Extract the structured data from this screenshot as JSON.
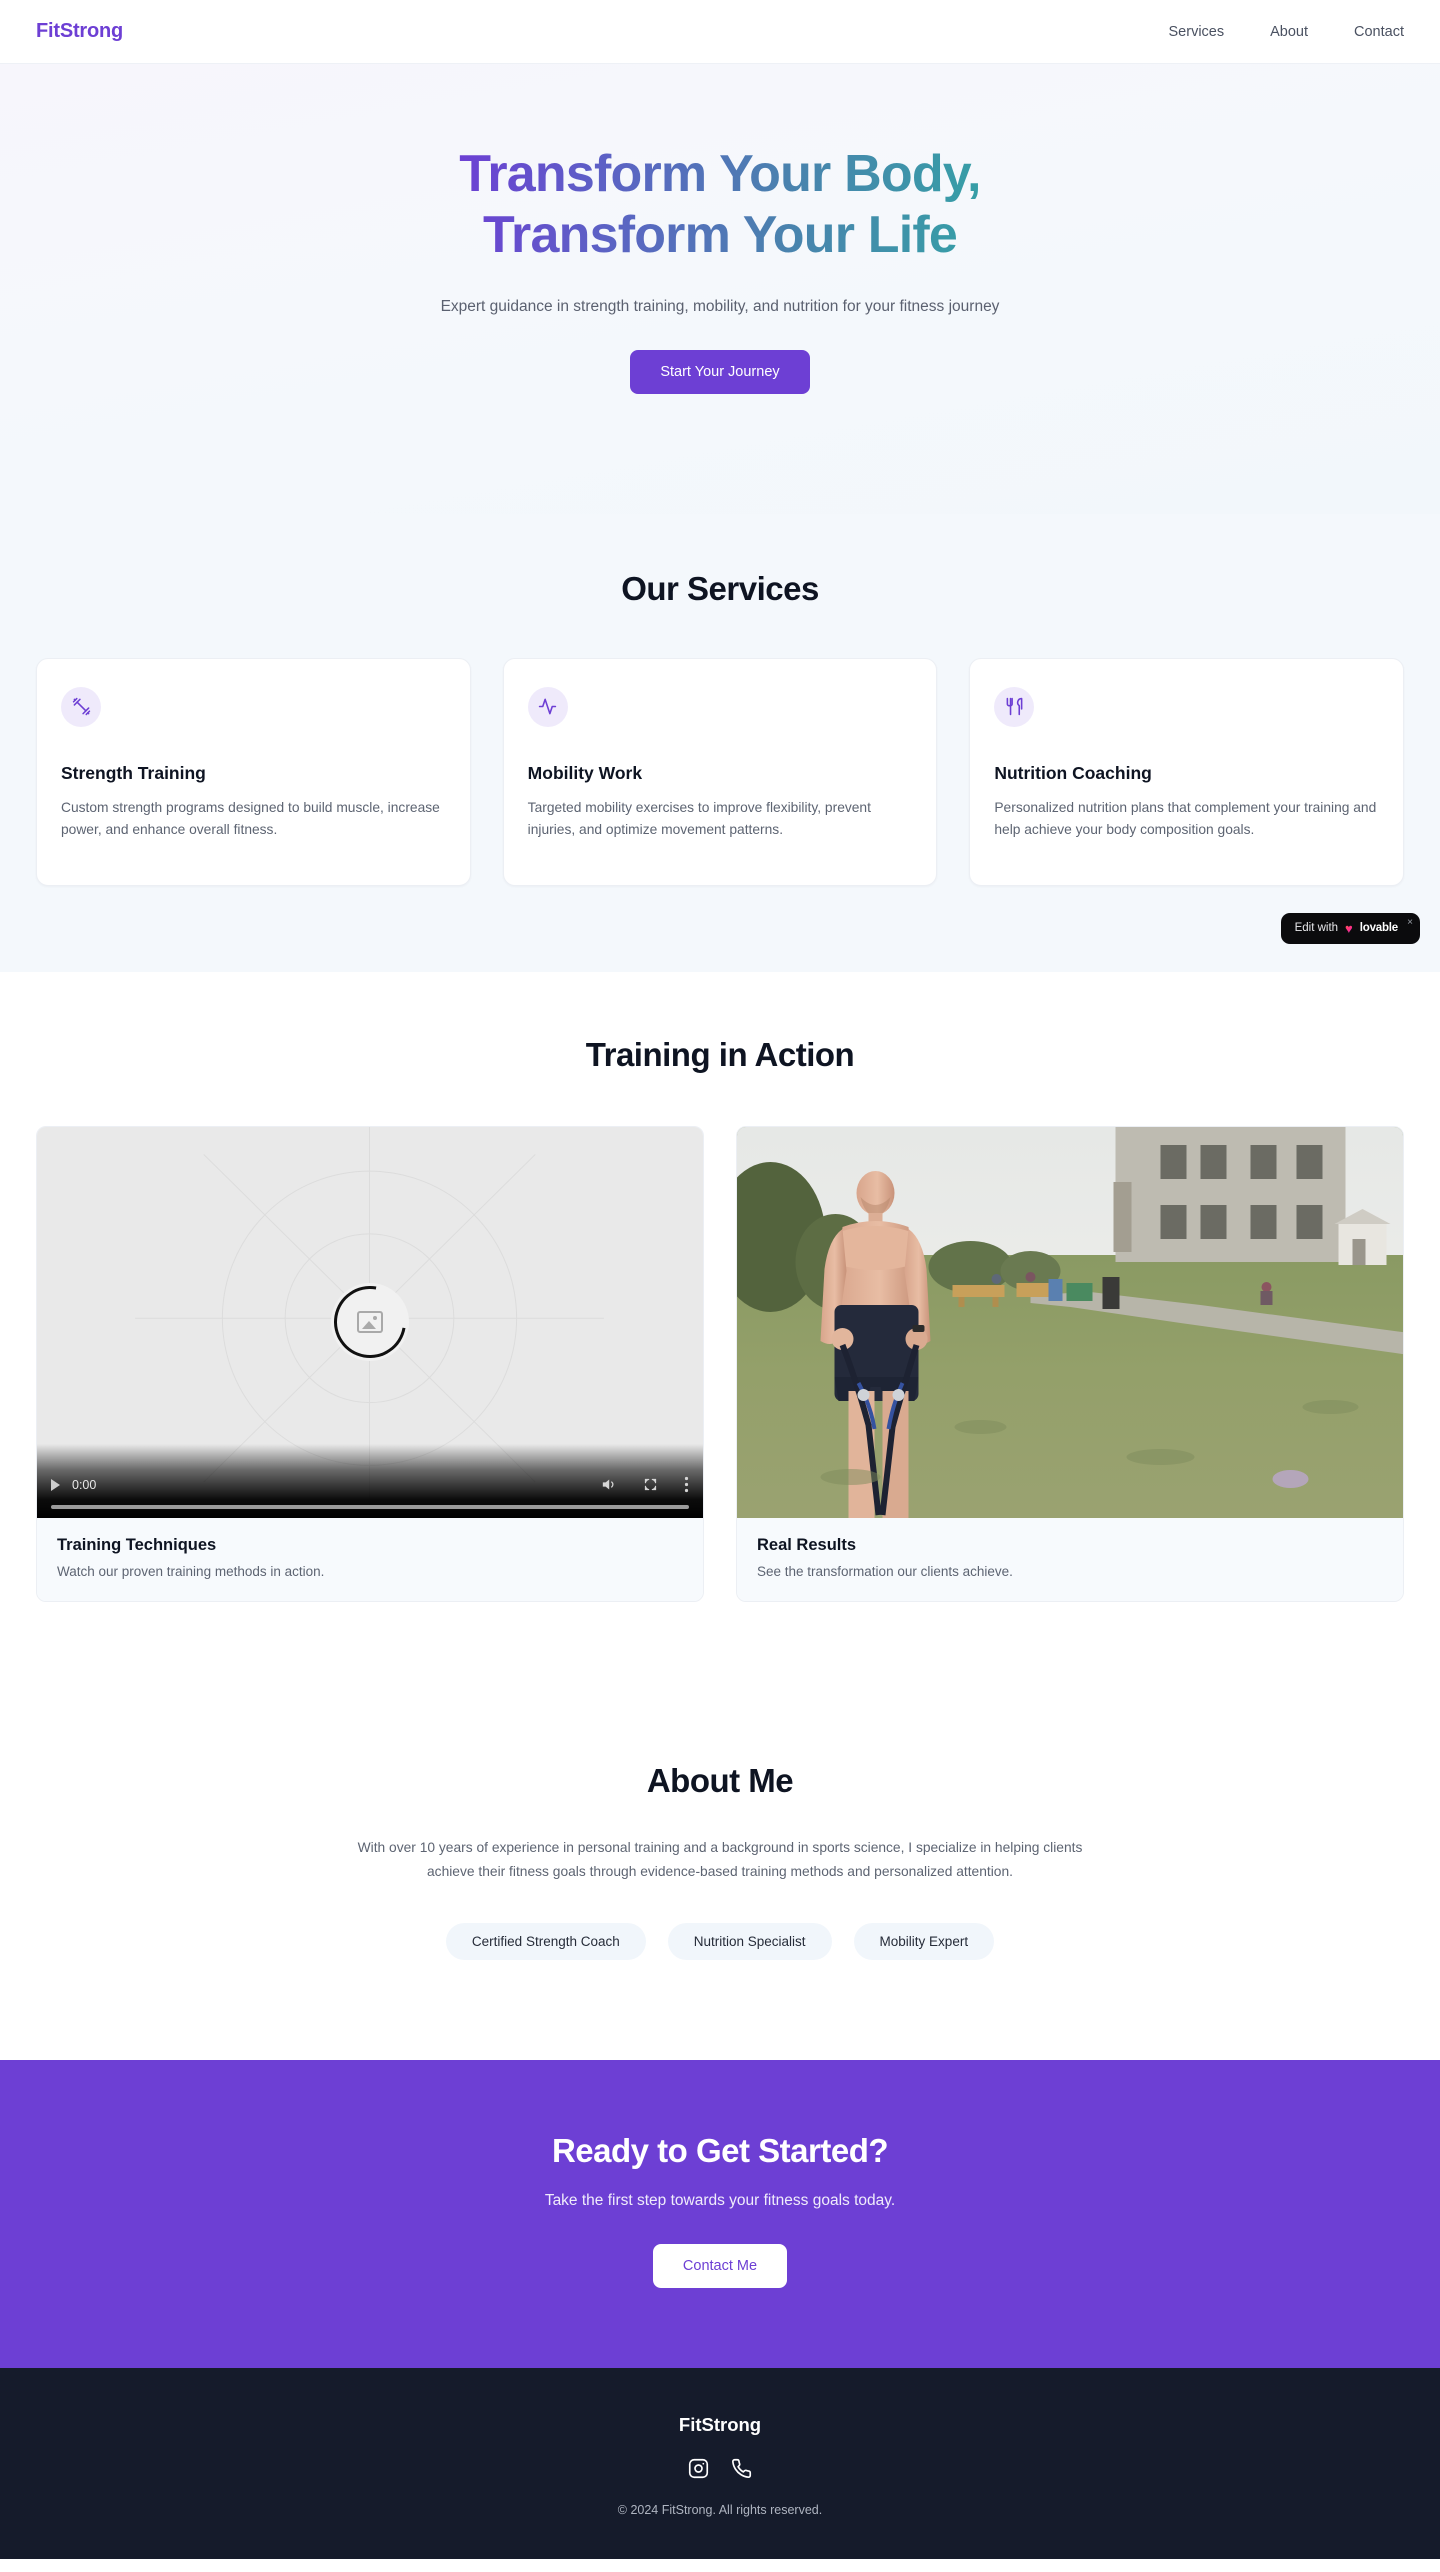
{
  "nav": {
    "brand": "FitStrong",
    "links": [
      {
        "label": "Services"
      },
      {
        "label": "About"
      },
      {
        "label": "Contact"
      }
    ]
  },
  "hero": {
    "title_line1": "Transform Your Body,",
    "title_line2": "Transform Your Life",
    "subtitle": "Expert guidance in strength training, mobility, and nutrition for your fitness journey",
    "cta_label": "Start Your Journey",
    "gradient_from": "#6d3fd4",
    "gradient_to": "#35a0a6"
  },
  "services": {
    "title": "Our Services",
    "cards": [
      {
        "icon": "dumbbell-icon",
        "title": "Strength Training",
        "desc": "Custom strength programs designed to build muscle, increase power, and enhance overall fitness."
      },
      {
        "icon": "activity-pulse-icon",
        "title": "Mobility Work",
        "desc": "Targeted mobility exercises to improve flexibility, prevent injuries, and optimize movement patterns."
      },
      {
        "icon": "utensils-icon",
        "title": "Nutrition Coaching",
        "desc": "Personalized nutrition plans that complement your training and help achieve your body composition goals."
      }
    ]
  },
  "lovable_badge": {
    "prefix": "Edit with",
    "heart": "♥",
    "name": "lovable",
    "close": "×"
  },
  "media": {
    "title": "Training in Action",
    "video_card": {
      "title": "Training Techniques",
      "desc": "Watch our proven training methods in action.",
      "current_time": "0:00",
      "controls": [
        "play-button",
        "volume-button",
        "fullscreen-button",
        "more-options-button"
      ]
    },
    "photo_card": {
      "title": "Real Results",
      "desc": "See the transformation our clients achieve.",
      "alt": "Shirtless man training with resistance bands on grass in front of a stone building"
    }
  },
  "about": {
    "title": "About Me",
    "text": "With over 10 years of experience in personal training and a background in sports science, I specialize in helping clients achieve their fitness goals through evidence-based training methods and personalized attention.",
    "badges": [
      {
        "label": "Certified Strength Coach"
      },
      {
        "label": "Nutrition Specialist"
      },
      {
        "label": "Mobility Expert"
      }
    ]
  },
  "cta": {
    "title": "Ready to Get Started?",
    "subtitle": "Take the first step towards your fitness goals today.",
    "button": "Contact Me",
    "bg": "#6d3fd4"
  },
  "footer": {
    "brand": "FitStrong",
    "socials": [
      {
        "name": "instagram-icon"
      },
      {
        "name": "phone-icon"
      }
    ],
    "copyright": "© 2024 FitStrong. All rights reserved.",
    "bg": "#151b2b"
  }
}
